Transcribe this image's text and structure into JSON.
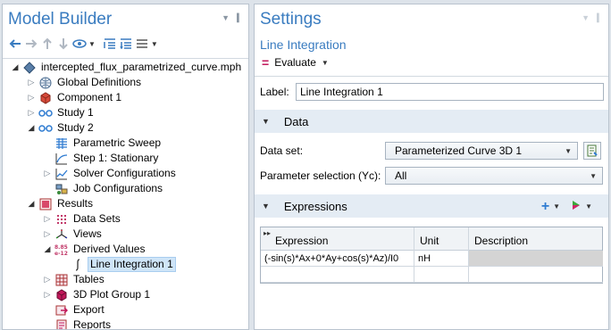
{
  "model_builder": {
    "title": "Model Builder",
    "tree": [
      {
        "label": "intercepted_flux_parametrized_curve.mph",
        "depth": 0,
        "toggle": "open",
        "icon": "model-icon",
        "selected": false
      },
      {
        "label": "Global Definitions",
        "depth": 1,
        "toggle": "closed",
        "icon": "globe-icon",
        "selected": false
      },
      {
        "label": "Component 1",
        "depth": 1,
        "toggle": "closed",
        "icon": "component-icon",
        "selected": false
      },
      {
        "label": "Study 1",
        "depth": 1,
        "toggle": "closed",
        "icon": "study-icon",
        "selected": false
      },
      {
        "label": "Study 2",
        "depth": 1,
        "toggle": "open",
        "icon": "study-icon",
        "selected": false
      },
      {
        "label": "Parametric Sweep",
        "depth": 2,
        "toggle": "",
        "icon": "parametric-sweep-icon",
        "selected": false
      },
      {
        "label": "Step 1: Stationary",
        "depth": 2,
        "toggle": "",
        "icon": "stationary-step-icon",
        "selected": false
      },
      {
        "label": "Solver Configurations",
        "depth": 2,
        "toggle": "closed",
        "icon": "solver-config-icon",
        "selected": false
      },
      {
        "label": "Job Configurations",
        "depth": 2,
        "toggle": "",
        "icon": "job-config-icon",
        "selected": false
      },
      {
        "label": "Results",
        "depth": 1,
        "toggle": "open",
        "icon": "results-icon",
        "selected": false
      },
      {
        "label": "Data Sets",
        "depth": 2,
        "toggle": "closed",
        "icon": "datasets-icon",
        "selected": false
      },
      {
        "label": "Views",
        "depth": 2,
        "toggle": "closed",
        "icon": "views-icon",
        "selected": false
      },
      {
        "label": "Derived Values",
        "depth": 2,
        "toggle": "open",
        "icon": "derived-values-icon",
        "selected": false
      },
      {
        "label": "Line Integration 1",
        "depth": 3,
        "toggle": "",
        "icon": "integral-icon",
        "selected": true
      },
      {
        "label": "Tables",
        "depth": 2,
        "toggle": "closed",
        "icon": "tables-icon",
        "selected": false
      },
      {
        "label": "3D Plot Group 1",
        "depth": 2,
        "toggle": "closed",
        "icon": "plot-group-icon",
        "selected": false
      },
      {
        "label": "Export",
        "depth": 2,
        "toggle": "",
        "icon": "export-icon",
        "selected": false
      },
      {
        "label": "Reports",
        "depth": 2,
        "toggle": "",
        "icon": "reports-icon",
        "selected": false
      }
    ]
  },
  "settings": {
    "title": "Settings",
    "subtitle": "Line Integration",
    "evaluate_label": "Evaluate",
    "label_field": {
      "label": "Label:",
      "value": "Line Integration 1"
    },
    "data_section": {
      "title": "Data",
      "dataset_label": "Data set:",
      "dataset_value": "Parameterized Curve 3D 1",
      "param_label": "Parameter selection (Yc):",
      "param_value": "All"
    },
    "expressions_section": {
      "title": "Expressions",
      "columns": [
        "Expression",
        "Unit",
        "Description"
      ],
      "rows": [
        {
          "expression": "(-sin(s)*Ax+0*Ay+cos(s)*Az)/I0",
          "unit": "nH",
          "description": ""
        }
      ]
    }
  },
  "colors": {
    "accent": "#3a7cc0",
    "section_bg": "#e4ecf4",
    "selection": "#cfe5f8"
  }
}
